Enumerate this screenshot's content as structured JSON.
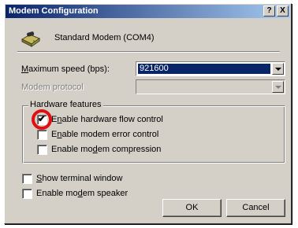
{
  "window": {
    "title": "Modem Configuration",
    "help_button": "?",
    "close_button": "X"
  },
  "modem": {
    "icon": "modem-icon",
    "name": "Standard Modem (COM4)"
  },
  "max_speed": {
    "label_accel": "M",
    "label_rest": "aximum speed (bps):",
    "value": "921600"
  },
  "protocol": {
    "label": "Modem protocol",
    "value": ""
  },
  "hardware_features": {
    "title": "Hardware features",
    "items": [
      {
        "label_pre": "E",
        "label_accel": "n",
        "label_post": "able hardware flow control",
        "checked": true
      },
      {
        "label_pre": "E",
        "label_accel": "n",
        "label_post": "able modem error control",
        "checked": false
      },
      {
        "label_pre": "Enable mo",
        "label_accel": "d",
        "label_post": "em compression",
        "checked": false
      }
    ]
  },
  "options": [
    {
      "label_pre": "",
      "label_accel": "S",
      "label_post": "how terminal window",
      "checked": false
    },
    {
      "label_pre": "Enable mo",
      "label_accel": "d",
      "label_post": "em speaker",
      "checked": false
    }
  ],
  "buttons": {
    "ok": "OK",
    "cancel": "Cancel"
  },
  "colors": {
    "title_start": "#0a246a",
    "title_end": "#a6caf0",
    "dialog_face": "#d4d0c8",
    "highlight_ring": "#e01010"
  }
}
